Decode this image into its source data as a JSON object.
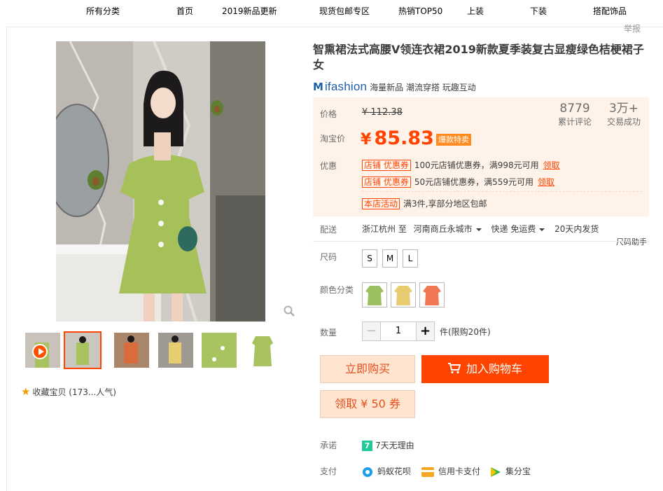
{
  "nav": {
    "items": [
      "所有分类",
      "首页",
      "2019新品更新",
      "现货包邮专区",
      "热销TOP50",
      "上装",
      "下装",
      "搭配饰品"
    ]
  },
  "report_label": "举报",
  "product": {
    "title": "智熏裙法式高腰V领连衣裙2019新款夏季装复古显瘦绿色桔梗裙子女",
    "brand_logo_text": "ifashion",
    "brand_tags": "海量新品 潮流穿搭 玩趣互动"
  },
  "price": {
    "label": "价格",
    "original": "¥ 112.38",
    "tb_label": "淘宝价",
    "currency": "¥",
    "current": "85.83",
    "hot_tag": "爆款特卖",
    "reviews_count": "8779",
    "reviews_label": "累计评论",
    "sales_count": "3万+",
    "sales_label": "交易成功"
  },
  "promotions": {
    "label": "优惠",
    "coupons": [
      {
        "tag": "店铺 优惠券",
        "text": "100元店铺优惠券，满998元可用",
        "link": "领取"
      },
      {
        "tag": "店铺 优惠券",
        "text": "50元店铺优惠券，满559元可用",
        "link": "领取"
      }
    ],
    "activity_tag": "本店活动",
    "activity_text": "满3件,享部分地区包邮"
  },
  "delivery": {
    "label": "配送",
    "from": "浙江杭州 至",
    "to": "河南商丘永城市",
    "shipping": "快递 免运费",
    "eta": "20天内发货"
  },
  "size": {
    "label": "尺码",
    "options": [
      "S",
      "M",
      "L"
    ],
    "helper": "尺码助手"
  },
  "color": {
    "label": "颜色分类",
    "swatches": [
      "#9cc060",
      "#e8cc70",
      "#f07855"
    ]
  },
  "quantity": {
    "label": "数量",
    "minus": "−",
    "value": "1",
    "plus": "+",
    "limit": "件(限购20件)"
  },
  "buttons": {
    "buy_now": "立即购买",
    "add_cart": "加入购物车",
    "get_coupon": "领取 ¥ 50 券"
  },
  "promise": {
    "label": "承诺",
    "icon_text": "7",
    "text": "7天无理由"
  },
  "payment": {
    "label": "支付",
    "methods": [
      "蚂蚁花呗",
      "信用卡支付",
      "集分宝"
    ]
  },
  "favorite": "收藏宝贝 (173...人气)",
  "colors": {
    "accent": "#ff4400",
    "price_bg": "#fff2e8",
    "brand_blue": "#1f5fa8"
  }
}
